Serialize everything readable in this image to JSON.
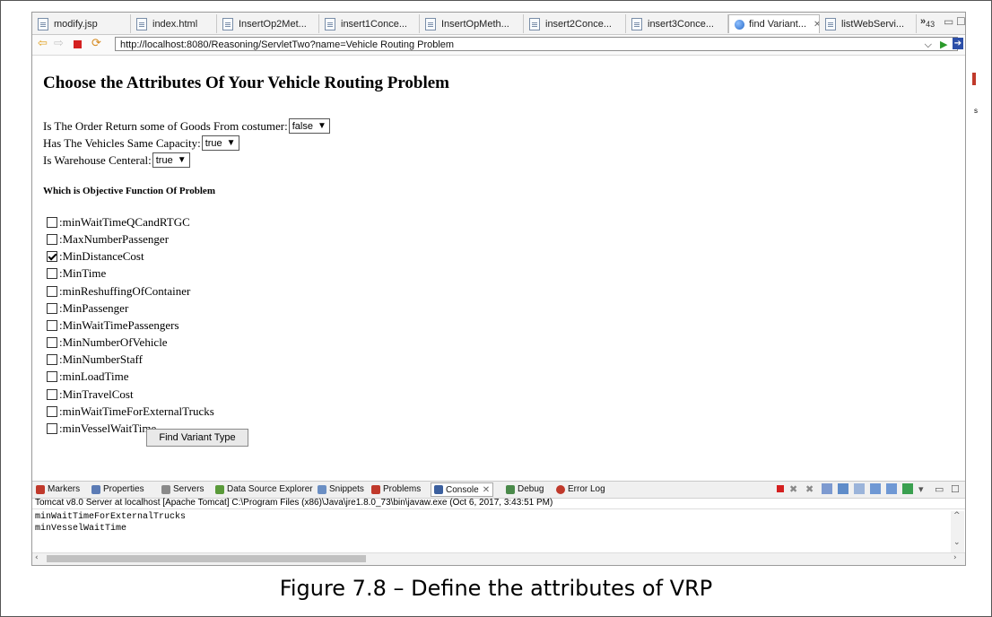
{
  "browser": {
    "tabs": [
      {
        "label": "modify.jsp",
        "icon": "file-icon"
      },
      {
        "label": "index.html",
        "icon": "file-icon"
      },
      {
        "label": "InsertOp2Met...",
        "icon": "file-icon"
      },
      {
        "label": "insert1Conce...",
        "icon": "file-icon"
      },
      {
        "label": "InsertOpMeth...",
        "icon": "file-icon"
      },
      {
        "label": "insert2Conce...",
        "icon": "file-icon"
      },
      {
        "label": "insert3Conce...",
        "icon": "file-icon"
      },
      {
        "label": "find Variant...",
        "icon": "globe-icon",
        "active": true
      },
      {
        "label": "listWebServi...",
        "icon": "file-icon"
      }
    ],
    "overflow_label": "»",
    "overflow_count": "43",
    "url": "http://localhost:8080/Reasoning/ServletTwo?name=Vehicle Routing Problem"
  },
  "page": {
    "heading": "Choose the Attributes Of Your Vehicle Routing Problem",
    "attributes": [
      {
        "label": "Is The Order Return some of Goods From costumer:",
        "value": "false"
      },
      {
        "label": "Has The Vehicles Same Capacity:",
        "value": "true"
      },
      {
        "label": "Is Warehouse Centeral:",
        "value": "true"
      }
    ],
    "objective_heading": "Which is Objective Function Of Problem",
    "objectives": [
      {
        "label": ":minWaitTimeQCandRTGC",
        "checked": false
      },
      {
        "label": ":MaxNumberPassenger",
        "checked": false
      },
      {
        "label": ":MinDistanceCost",
        "checked": true
      },
      {
        "label": ":MinTime",
        "checked": false
      },
      {
        "label": ":minReshuffingOfContainer",
        "checked": false
      },
      {
        "label": ":MinPassenger",
        "checked": false
      },
      {
        "label": ":MinWaitTimePassengers",
        "checked": false
      },
      {
        "label": ":MinNumberOfVehicle",
        "checked": false
      },
      {
        "label": ":MinNumberStaff",
        "checked": false
      },
      {
        "label": ":minLoadTime",
        "checked": false
      },
      {
        "label": ":MinTravelCost",
        "checked": false
      },
      {
        "label": ":minWaitTimeForExternalTrucks",
        "checked": false
      },
      {
        "label": ":minVesselWaitTime",
        "checked": false
      }
    ],
    "submit_label": "Find Variant Type"
  },
  "console": {
    "views": [
      {
        "label": "Markers",
        "color": "#c0392b"
      },
      {
        "label": "Properties",
        "color": "#5b7bb5"
      },
      {
        "label": "Servers",
        "color": "#8a8a8a"
      },
      {
        "label": "Data Source Explorer",
        "color": "#5a9a3a"
      },
      {
        "label": "Snippets",
        "color": "#6b8fc4"
      },
      {
        "label": "Problems",
        "color": "#c0392b"
      },
      {
        "label": "Console",
        "color": "#3b5f9e",
        "active": true
      },
      {
        "label": "Debug",
        "color": "#4a8a4a"
      },
      {
        "label": "Error Log",
        "color": "#c0392b"
      }
    ],
    "status": "Tomcat v8.0 Server at localhost [Apache Tomcat] C:\\Program Files (x86)\\Java\\jre1.8.0_73\\bin\\javaw.exe (Oct 6, 2017, 3:43:51 PM)",
    "output": [
      "minWaitTimeForExternalTrucks",
      "minVesselWaitTime"
    ]
  },
  "caption": "Figure 7.8 – Define the attributes of VRP"
}
